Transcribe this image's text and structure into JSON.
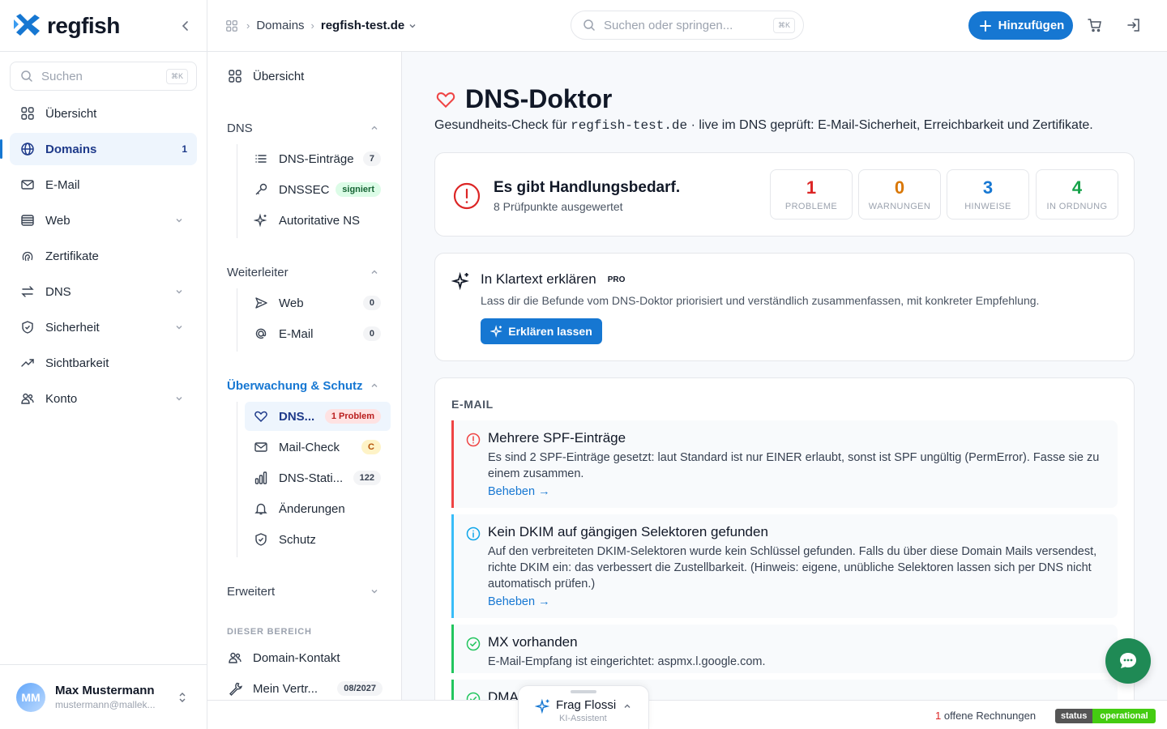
{
  "app": {
    "logo_text": "regfish"
  },
  "sidebar": {
    "search_placeholder": "Suchen",
    "search_kbd": "⌘K",
    "items": [
      {
        "label": "Übersicht",
        "icon": "grid-icon"
      },
      {
        "label": "Domains",
        "icon": "globe-icon",
        "count": "1",
        "active": true
      },
      {
        "label": "E-Mail",
        "icon": "mail-icon"
      },
      {
        "label": "Web",
        "icon": "server-icon"
      },
      {
        "label": "Zertifikate",
        "icon": "fingerprint-icon"
      },
      {
        "label": "DNS",
        "icon": "arrows-icon"
      },
      {
        "label": "Sicherheit",
        "icon": "shield-icon"
      },
      {
        "label": "Sichtbarkeit",
        "icon": "trending-icon"
      },
      {
        "label": "Konto",
        "icon": "users-icon"
      }
    ],
    "user": {
      "initials": "MM",
      "name": "Max Mustermann",
      "email": "mustermann@mallek..."
    }
  },
  "topbar": {
    "breadcrumb": [
      "Domains",
      "regfish-test.de"
    ],
    "search_placeholder": "Suchen oder springen...",
    "search_kbd": "⌘K",
    "add_label": "Hinzufügen"
  },
  "subnav": {
    "overview": "Übersicht",
    "dns": {
      "title": "DNS",
      "items": [
        {
          "label": "DNS-Einträge",
          "badge": "7"
        },
        {
          "label": "DNSSEC",
          "badge": "signiert"
        },
        {
          "label": "Autoritative NS"
        }
      ]
    },
    "forwarder": {
      "title": "Weiterleiter",
      "items": [
        {
          "label": "Web",
          "badge": "0"
        },
        {
          "label": "E-Mail",
          "badge": "0"
        }
      ]
    },
    "monitoring": {
      "title": "Überwachung & Schutz",
      "items": [
        {
          "label": "DNS...",
          "badge": "1 Problem"
        },
        {
          "label": "Mail-Check",
          "badge": "C"
        },
        {
          "label": "DNS-Stati...",
          "badge": "122"
        },
        {
          "label": "Änderungen"
        },
        {
          "label": "Schutz"
        }
      ]
    },
    "advanced": "Erweitert",
    "section_label": "DIESER BEREICH",
    "area_items": [
      {
        "label": "Domain-Kontakt"
      },
      {
        "label": "Mein Vertr...",
        "badge": "08/2027"
      }
    ]
  },
  "main": {
    "title": "DNS-Doktor",
    "subtitle_pre": "Gesundheits-Check für",
    "subtitle_domain": "regfish-test.de",
    "subtitle_post": "· live im DNS geprüft: E-Mail-Sicherheit, Erreichbarkeit und Zertifikate.",
    "status": {
      "headline": "Es gibt Handlungsbedarf.",
      "sub": "8 Prüfpunkte ausgewertet",
      "stats": [
        {
          "value": "1",
          "label": "PROBLEME",
          "color": "#dc2626"
        },
        {
          "value": "0",
          "label": "WARNUNGEN",
          "color": "#d97706"
        },
        {
          "value": "3",
          "label": "HINWEISE",
          "color": "#1677d2"
        },
        {
          "value": "4",
          "label": "IN ORDNUNG",
          "color": "#16a34a"
        }
      ]
    },
    "ai": {
      "title": "In Klartext erklären",
      "pro": "PRO",
      "desc": "Lass dir die Befunde vom DNS-Doktor priorisiert und verständlich zusammenfassen, mit konkreter Empfehlung.",
      "button": "Erklären lassen"
    },
    "email_section": {
      "title": "E-MAIL",
      "findings": [
        {
          "title": "Mehrere SPF-Einträge",
          "desc": "Es sind 2 SPF-Einträge gesetzt: laut Standard ist nur EINER erlaubt, sonst ist SPF ungültig (PermError). Fasse sie zu einem zusammen.",
          "link": "Beheben →"
        },
        {
          "title": "Kein DKIM auf gängigen Selektoren gefunden",
          "desc": "Auf den verbreiteten DKIM-Selektoren wurde kein Schlüssel gefunden. Falls du über diese Domain Mails versendest, richte DKIM ein: das verbessert die Zustellbarkeit. (Hinweis: eigene, unübliche Selektoren lassen sich per DNS nicht automatisch prüfen.)",
          "link": "Beheben →"
        },
        {
          "title": "MX vorhanden",
          "desc": "E-Mail-Empfang ist eingerichtet: aspmx.l.google.com."
        },
        {
          "title": "DMA"
        }
      ]
    }
  },
  "bottom": {
    "invoices_count": "1",
    "invoices_label": " offene Rechnungen",
    "status_left": "status",
    "status_right": "operational"
  },
  "assistant": {
    "title": "Frag Flossi",
    "subtitle": "KI-Assistent"
  },
  "colors": {
    "accent": "#1677d2",
    "danger": "#dc2626",
    "ok": "#16a34a",
    "chat": "#1f8a55"
  }
}
